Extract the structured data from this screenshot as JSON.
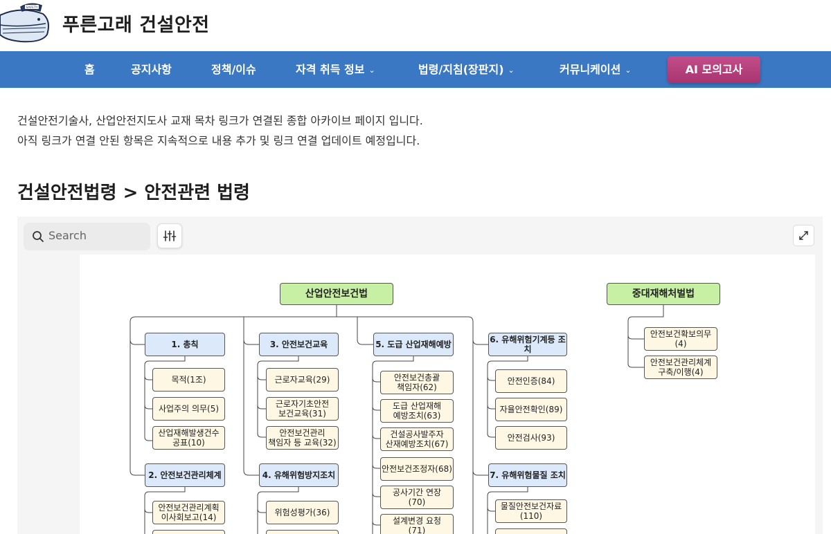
{
  "header": {
    "site_title": "푸른고래 건설안전",
    "logo_text": "SAFETY"
  },
  "nav": {
    "items": [
      {
        "label": "홈"
      },
      {
        "label": "공지사항"
      },
      {
        "label": "정책/이슈"
      },
      {
        "label": "자격 취득 정보",
        "dropdown": true
      },
      {
        "label": "법령/지침(장판지)",
        "dropdown": true
      },
      {
        "label": "커뮤니케이션",
        "dropdown": true
      }
    ],
    "ai_button": "AI 모의고사",
    "dropdown_icon": "chevron-down-icon"
  },
  "intro": {
    "line1": "건설안전기술사, 산업안전지도사 교재 목차 링크가 연결된 종합 아카이브 페이지 입니다.",
    "line2": "아직 링크가 연결 안된 항목은 지속적으로 내용 추가 및 링크 연결 업데이트 예정입니다."
  },
  "section_title": "건설안전법령 > 안전관련 법령",
  "mindmap": {
    "search_placeholder": "Search",
    "root_main": "산업안전보건법",
    "root_second": "중대재해처벌법",
    "sections": {
      "s1": "1. 총칙",
      "s2": "2. 안전보건관리체계",
      "s3": "3. 안전보건교육",
      "s4": "4. 유해위험방지조치",
      "s5": "5. 도급 산업재해예방",
      "s6": "6. 유해위험기계등 조치",
      "s7": "7. 유해위험물질 조치"
    },
    "leaves": {
      "s1": [
        "목적(1조)",
        "사업주의 의무(5)",
        "산업재해발생건수\n공표(10)"
      ],
      "s2": [
        "안전보건관리계획\n이사회보고(14)"
      ],
      "s3": [
        "근로자교육(29)",
        "근로자기초안전\n보건교육(31)",
        "안전보건관리\n책임자 등 교육(32)"
      ],
      "s4": [
        "위험성평가(36)"
      ],
      "s5": [
        "안전보건총괄\n책임자(62)",
        "도급 산업재해\n예방조치(63)",
        "건설공사발주자\n산재예방조치(67)",
        "안전보건조정자(68)",
        "공사기간 연장\n(70)",
        "설계변경 요청\n(71)"
      ],
      "s6": [
        "안전인증(84)",
        "자율안전확인(89)",
        "안전검사(93)"
      ],
      "s7": [
        "물질안전보건자료\n(110)"
      ],
      "serious": [
        "안전보건확보의무(4)",
        "안전보건관리체계\n구축/이행(4)"
      ]
    }
  },
  "colors": {
    "nav_bg": "#3a78c4",
    "ai_button": "#b54079",
    "root_node": "#c8f0a4",
    "section_node": "#dce9fa",
    "leaf_node": "#fdf7e4"
  }
}
